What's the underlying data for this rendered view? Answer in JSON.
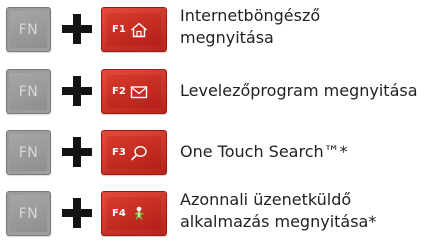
{
  "shortcuts": [
    {
      "modifier": "FN",
      "key": "F1",
      "icon": "home-icon",
      "lines": [
        "Internetböngésző",
        "megnyitása"
      ]
    },
    {
      "modifier": "FN",
      "key": "F2",
      "icon": "envelope-icon",
      "lines": [
        "Levelezőprogram megnyitása"
      ]
    },
    {
      "modifier": "FN",
      "key": "F3",
      "icon": "search-icon",
      "lines": [
        "One Touch Search™*"
      ]
    },
    {
      "modifier": "FN",
      "key": "F4",
      "icon": "messenger-icon",
      "lines": [
        "Azonnali üzenetküldő",
        "alkalmazás megnyitása*"
      ]
    }
  ],
  "colors": {
    "fn_key": "#9a9a9a",
    "function_key": "#c8271d",
    "plus": "#141414",
    "text": "#222222"
  }
}
